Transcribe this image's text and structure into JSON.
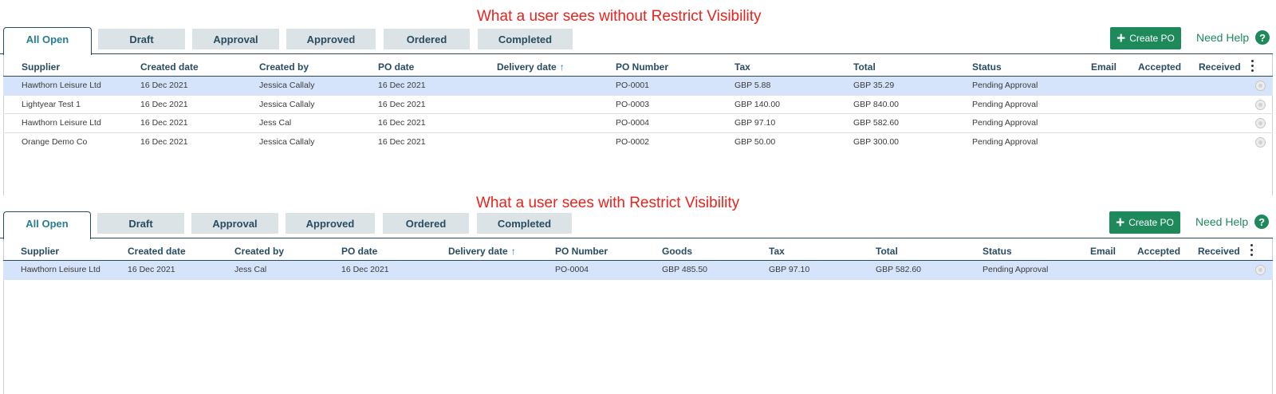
{
  "captions": {
    "top": "What a user sees without Restrict Visibility",
    "bottom": "What a user sees with Restrict Visibility"
  },
  "colors": {
    "accent": "#1e8a5c",
    "tab_active_text": "#2a7d93",
    "caption": "#e8231e",
    "selected_row": "#d6e4fb"
  },
  "panel1": {
    "tabs": [
      "All Open",
      "Draft",
      "Approval",
      "Approved",
      "Ordered",
      "Completed"
    ],
    "active_tab": "All Open",
    "create_label": "Create PO",
    "help_label": "Need Help",
    "help_icon": "?",
    "columns": [
      "Supplier",
      "Created date",
      "Created by",
      "PO date",
      "Delivery date",
      "PO Number",
      "Tax",
      "Total",
      "Status",
      "Email",
      "Accepted",
      "Received"
    ],
    "sort_arrow": "↑",
    "rows": [
      [
        "Hawthorn Leisure Ltd",
        "16 Dec 2021",
        "Jessica Callaly",
        "16 Dec 2021",
        "",
        "PO-0001",
        "GBP 5.88",
        "GBP 35.29",
        "Pending Approval"
      ],
      [
        "Lightyear Test 1",
        "16 Dec 2021",
        "Jessica Callaly",
        "16 Dec 2021",
        "",
        "PO-0003",
        "GBP 140.00",
        "GBP 840.00",
        "Pending Approval"
      ],
      [
        "Hawthorn Leisure Ltd",
        "16 Dec 2021",
        "Jess Cal",
        "16 Dec 2021",
        "",
        "PO-0004",
        "GBP 97.10",
        "GBP 582.60",
        "Pending Approval"
      ],
      [
        "Orange Demo Co",
        "16 Dec 2021",
        "Jessica Callaly",
        "16 Dec 2021",
        "",
        "PO-0002",
        "GBP 50.00",
        "GBP 300.00",
        "Pending Approval"
      ]
    ]
  },
  "panel2": {
    "tabs": [
      "All Open",
      "Draft",
      "Approval",
      "Approved",
      "Ordered",
      "Completed"
    ],
    "active_tab": "All Open",
    "create_label": "Create PO",
    "help_label": "Need Help",
    "help_icon": "?",
    "columns": [
      "Supplier",
      "Created date",
      "Created by",
      "PO date",
      "Delivery date",
      "PO Number",
      "Goods",
      "Tax",
      "Total",
      "Status",
      "Email",
      "Accepted",
      "Received"
    ],
    "sort_arrow": "↑",
    "rows": [
      [
        "Hawthorn Leisure Ltd",
        "16 Dec 2021",
        "Jess Cal",
        "16 Dec 2021",
        "",
        "PO-0004",
        "GBP 485.50",
        "GBP 97.10",
        "GBP 582.60",
        "Pending Approval"
      ]
    ]
  }
}
